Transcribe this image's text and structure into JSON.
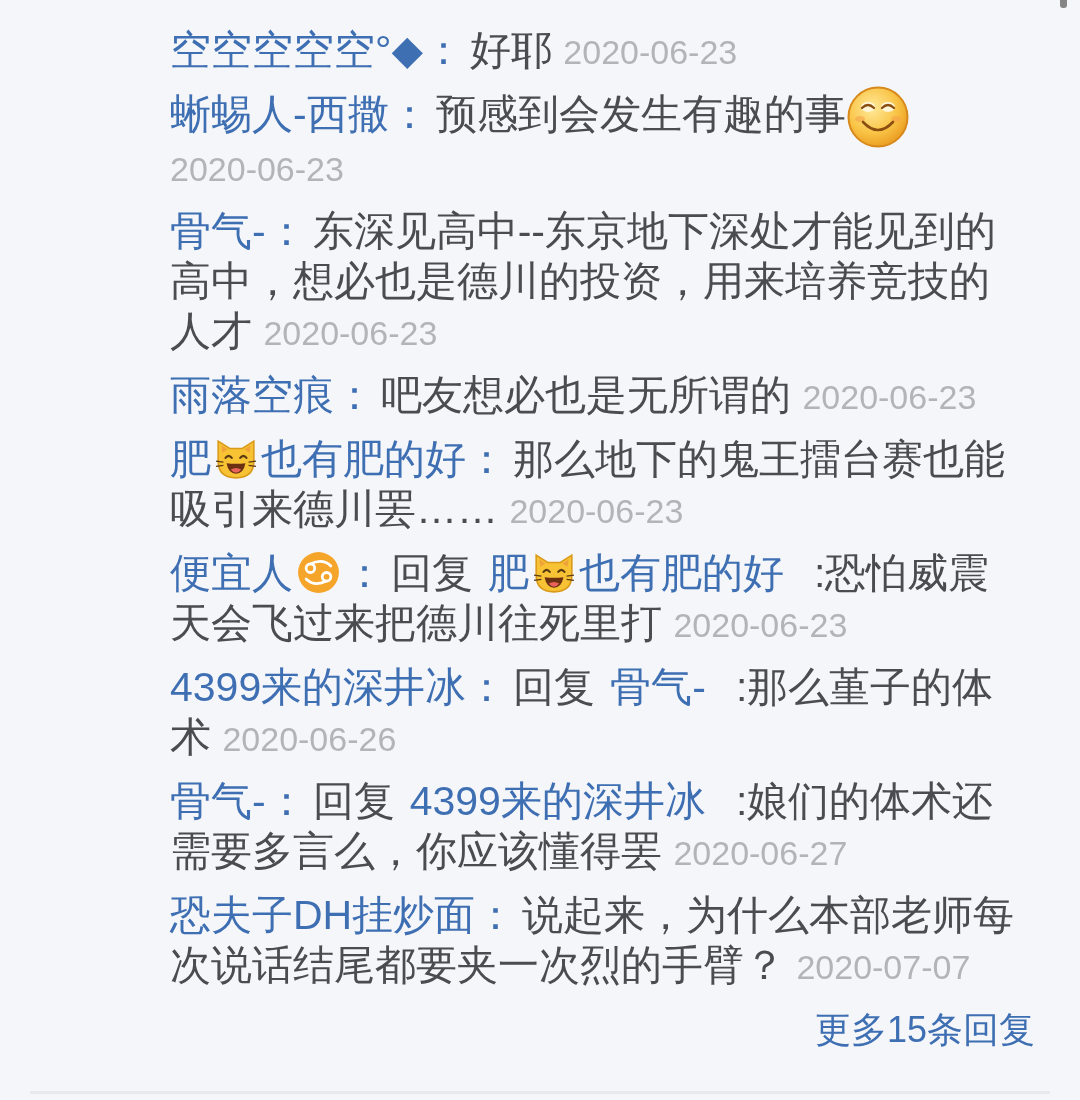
{
  "replies": [
    {
      "author": [
        {
          "kind": "text",
          "text": "空空空空空°◆："
        }
      ],
      "body": [
        {
          "kind": "text",
          "text": "好耶"
        }
      ],
      "date": "2020-06-23"
    },
    {
      "author": [
        {
          "kind": "text",
          "text": "蜥蜴人-西撒："
        }
      ],
      "body": [
        {
          "kind": "text",
          "text": "预感到会发生有趣的事"
        },
        {
          "kind": "smile_emoji"
        }
      ],
      "date": "2020-06-23"
    },
    {
      "author": [
        {
          "kind": "text",
          "text": "骨气-："
        }
      ],
      "body": [
        {
          "kind": "text",
          "text": "东深见高中--东京地下深处才能见到的高中，想必也是德川的投资，用来培养竞技的人才"
        }
      ],
      "date": "2020-06-23"
    },
    {
      "author": [
        {
          "kind": "text",
          "text": "雨落空痕："
        }
      ],
      "body": [
        {
          "kind": "text",
          "text": "吧友想必也是无所谓的"
        }
      ],
      "date": "2020-06-23"
    },
    {
      "author": [
        {
          "kind": "text",
          "text": "肥"
        },
        {
          "kind": "cat_emoji"
        },
        {
          "kind": "text",
          "text": "也有肥的好："
        }
      ],
      "body": [
        {
          "kind": "text",
          "text": "那么地下的鬼王擂台赛也能吸引来德川罢……"
        }
      ],
      "date": "2020-06-23"
    },
    {
      "author": [
        {
          "kind": "text",
          "text": "便宜人"
        },
        {
          "kind": "cancer_emoji"
        },
        {
          "kind": "text",
          "text": "："
        }
      ],
      "body": [
        {
          "kind": "text",
          "text": "回复"
        },
        {
          "kind": "mention",
          "parts": [
            {
              "kind": "text",
              "text": "肥"
            },
            {
              "kind": "cat_emoji"
            },
            {
              "kind": "text",
              "text": "也有肥的好"
            }
          ]
        },
        {
          "kind": "text",
          "text": ":恐怕威震天会飞过来把德川往死里打"
        }
      ],
      "date": "2020-06-23"
    },
    {
      "author": [
        {
          "kind": "text",
          "text": "4399来的深井冰："
        }
      ],
      "body": [
        {
          "kind": "text",
          "text": "回复"
        },
        {
          "kind": "mention",
          "parts": [
            {
              "kind": "text",
              "text": "骨气-"
            }
          ]
        },
        {
          "kind": "text",
          "text": ":那么堇子的体术"
        }
      ],
      "date": "2020-06-26"
    },
    {
      "author": [
        {
          "kind": "text",
          "text": "骨气-："
        }
      ],
      "body": [
        {
          "kind": "text",
          "text": "回复"
        },
        {
          "kind": "mention",
          "parts": [
            {
              "kind": "text",
              "text": "4399来的深井冰"
            }
          ]
        },
        {
          "kind": "text",
          "text": ":娘们的体术还需要多言么，你应该懂得罢"
        }
      ],
      "date": "2020-06-27"
    },
    {
      "author": [
        {
          "kind": "text",
          "text": "恐夫子DH挂炒面："
        }
      ],
      "body": [
        {
          "kind": "text",
          "text": "说起来，为什么本部老师每次说话结尾都要夹一次烈的手臂？"
        }
      ],
      "date": "2020-07-07"
    }
  ],
  "more_replies": "更多15条回复"
}
